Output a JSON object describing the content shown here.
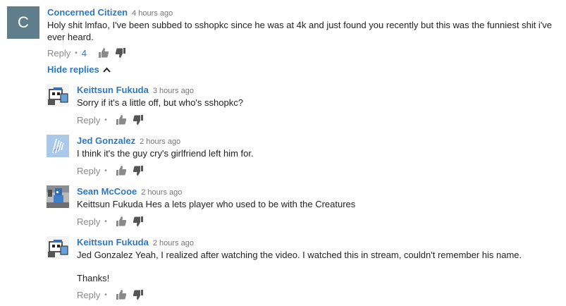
{
  "main_comment": {
    "avatar_letter": "C",
    "author": "Concerned Citizen",
    "time": "4 hours ago",
    "text": "Holy shit lmfao, I've been subbed to sshopkc since he was at 4k and just found you recently but this was the funniest shit i've ever heard.",
    "reply_label": "Reply",
    "like_count": "4"
  },
  "hide_replies_label": "Hide replies",
  "replies": [
    {
      "author": "Keittsun Fukuda",
      "time": "3 hours ago",
      "text": "Sorry if it's a little off, but who's sshopkc?",
      "reply_label": "Reply"
    },
    {
      "author": "Jed Gonzalez",
      "time": "2 hours ago",
      "text": "I think it's the guy cry's girlfriend left him for.",
      "reply_label": "Reply"
    },
    {
      "author": "Sean McCooe",
      "time": "2 hours ago",
      "text": "Keittsun Fukuda Hes a lets player who used to be with the Creatures",
      "reply_label": "Reply"
    },
    {
      "author": "Keittsun Fukuda",
      "time": "2 hours ago",
      "text": "Jed Gonzalez Yeah, I realized after watching the video. I watched this in stream, couldn't remember his name.",
      "text2": "Thanks!",
      "reply_label": "Reply"
    }
  ],
  "colors": {
    "link_blue": "#2b78c5",
    "avatar_bg": "#607d8b",
    "muted": "#8a8a8a"
  },
  "icons": [
    "thumbs-up-icon",
    "thumbs-down-icon",
    "chevron-up-icon"
  ]
}
